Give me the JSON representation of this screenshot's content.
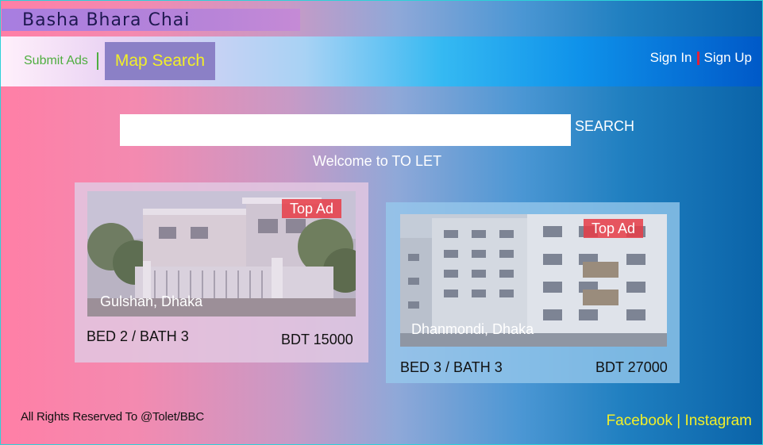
{
  "site": {
    "title": "Basha Bhara Chai"
  },
  "nav": {
    "submit_ads": "Submit Ads",
    "map_search": "Map Search",
    "sign_in": "Sign In",
    "sign_up": "Sign Up"
  },
  "search": {
    "placeholder": "",
    "button_label": "SEARCH"
  },
  "welcome": "Welcome to TO LET",
  "listings": [
    {
      "badge": "Top Ad",
      "location": "Gulshan, Dhaka",
      "rooms": "BED 2 / BATH 3",
      "price": "BDT 15000"
    },
    {
      "badge": "Top Ad",
      "location": "Dhanmondi, Dhaka",
      "rooms": "BED 3 / BATH 3",
      "price": "BDT 27000"
    }
  ],
  "footer": {
    "rights": "All Rights Reserved To @Tolet/BBC",
    "facebook": "Facebook",
    "separator": "|",
    "instagram": "Instagram"
  },
  "colors": {
    "accent_yellow": "#f2ef28",
    "submit_green": "#4fae40",
    "badge_red": "#e83c46",
    "title_purple": "#a77ee0"
  }
}
